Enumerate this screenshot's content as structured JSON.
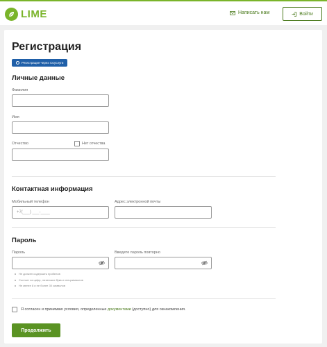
{
  "header": {
    "logo_text": "LIME",
    "write_us": "Написать нам",
    "login": "Войти"
  },
  "page": {
    "title": "Регистрация",
    "gosuslugi_button": "Регистрация через госуслуги"
  },
  "personal": {
    "title": "Личные данные",
    "surname_label": "Фамилия",
    "name_label": "Имя",
    "patronymic_label": "Отчество",
    "no_patronymic_label": "Нет отчества"
  },
  "contact": {
    "title": "Контактная информация",
    "phone_label": "Мобильный телефон",
    "phone_placeholder": "+7(___) ___-____",
    "email_label": "Адрес электронной почты"
  },
  "password": {
    "title": "Пароль",
    "password_label": "Пароль",
    "repeat_label": "Введите пароль повторно",
    "hints": [
      "Не должен содержать пробелов",
      "Состоит из цифр, латинских букв и спецсимволов",
      "Не менее 8 и не более 30 символов"
    ]
  },
  "agreement": {
    "text_before": "Я согласен и принимаю условия, определенные ",
    "link": "документами",
    "text_after": " (доступно) для ознакомления."
  },
  "submit": "Продолжить",
  "colors": {
    "brand_green": "#7ab42a",
    "button_green": "#5a9323",
    "gosuslugi_blue": "#1f5fa8"
  }
}
